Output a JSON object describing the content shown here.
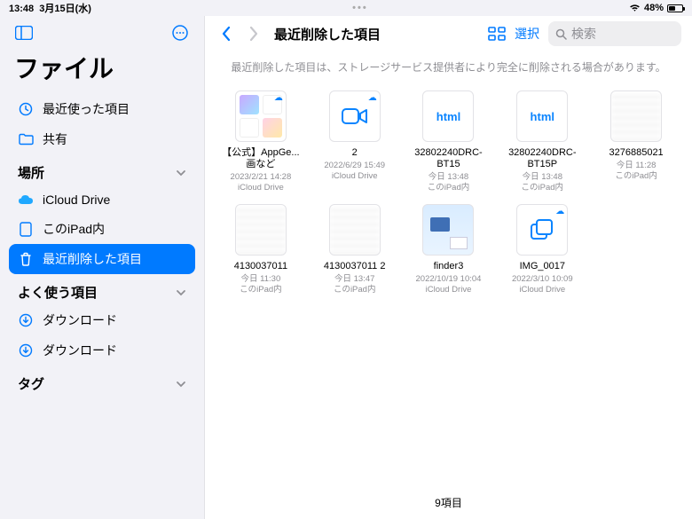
{
  "status": {
    "time": "13:48",
    "date": "3月15日(水)",
    "battery_pct": "48%"
  },
  "sidebar": {
    "title": "ファイル",
    "recent": "最近使った項目",
    "shared": "共有",
    "section_locations": "場所",
    "icloud": "iCloud Drive",
    "on_ipad": "このiPad内",
    "recently_deleted": "最近削除した項目",
    "section_favorites": "よく使う項目",
    "downloads1": "ダウンロード",
    "downloads2": "ダウンロード",
    "section_tags": "タグ"
  },
  "topbar": {
    "title": "最近削除した項目",
    "select": "選択",
    "search_placeholder": "検索"
  },
  "banner": "最近削除した項目は、ストレージサービス提供者により完全に削除される場合があります。",
  "items": [
    {
      "name": "【公式】AppGe...画など",
      "date": "2023/2/21 14:28",
      "loc": "iCloud Drive",
      "kind": "preview"
    },
    {
      "name": "2",
      "date": "2022/6/29 15:49",
      "loc": "iCloud Drive",
      "kind": "video"
    },
    {
      "name": "32802240DRC-BT15",
      "date": "今日 13:48",
      "loc": "このiPad内",
      "kind": "html"
    },
    {
      "name": "32802240DRC-BT15P",
      "date": "今日 13:48",
      "loc": "このiPad内",
      "kind": "html"
    },
    {
      "name": "3276885021",
      "date": "今日 11:28",
      "loc": "このiPad内",
      "kind": "blur"
    },
    {
      "name": "4130037011",
      "date": "今日 11:30",
      "loc": "このiPad内",
      "kind": "blur"
    },
    {
      "name": "4130037011 2",
      "date": "今日 13:47",
      "loc": "このiPad内",
      "kind": "blur"
    },
    {
      "name": "finder3",
      "date": "2022/10/19 10:04",
      "loc": "iCloud Drive",
      "kind": "screenshot"
    },
    {
      "name": "IMG_0017",
      "date": "2022/3/10 10:09",
      "loc": "iCloud Drive",
      "kind": "copy"
    }
  ],
  "footer": "9項目"
}
